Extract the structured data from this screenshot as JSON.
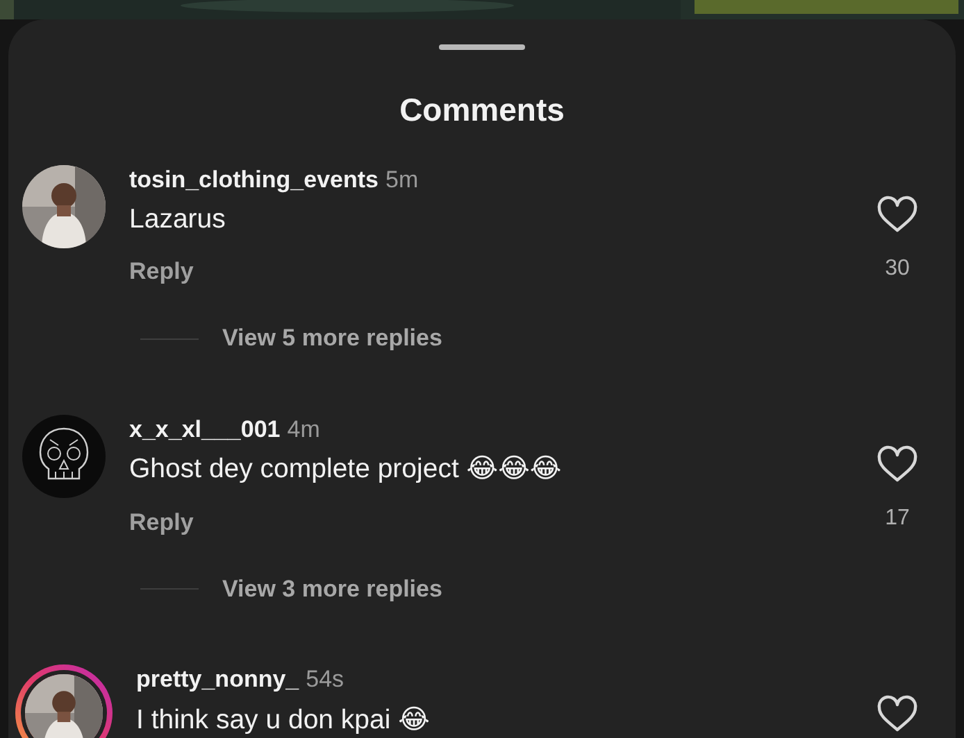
{
  "sheet": {
    "title": "Comments"
  },
  "comments": [
    {
      "username": "tosin_clothing_events",
      "time": "5m",
      "text": "Lazarus",
      "reply": "Reply",
      "likes": "30",
      "more_replies": "View 5 more replies",
      "avatar": {
        "kind": "picture",
        "story_ring": false
      }
    },
    {
      "username": "x_x_xl___001",
      "time": "4m",
      "text": "Ghost dey complete project 😂😂😂",
      "reply": "Reply",
      "likes": "17",
      "more_replies": "View 3 more replies",
      "avatar": {
        "kind": "skull",
        "story_ring": false
      }
    },
    {
      "username": "pretty_nonny_",
      "time": "54s",
      "text": "I think say u don kpai 😂",
      "avatar": {
        "kind": "picture",
        "story_ring": true
      }
    }
  ]
}
